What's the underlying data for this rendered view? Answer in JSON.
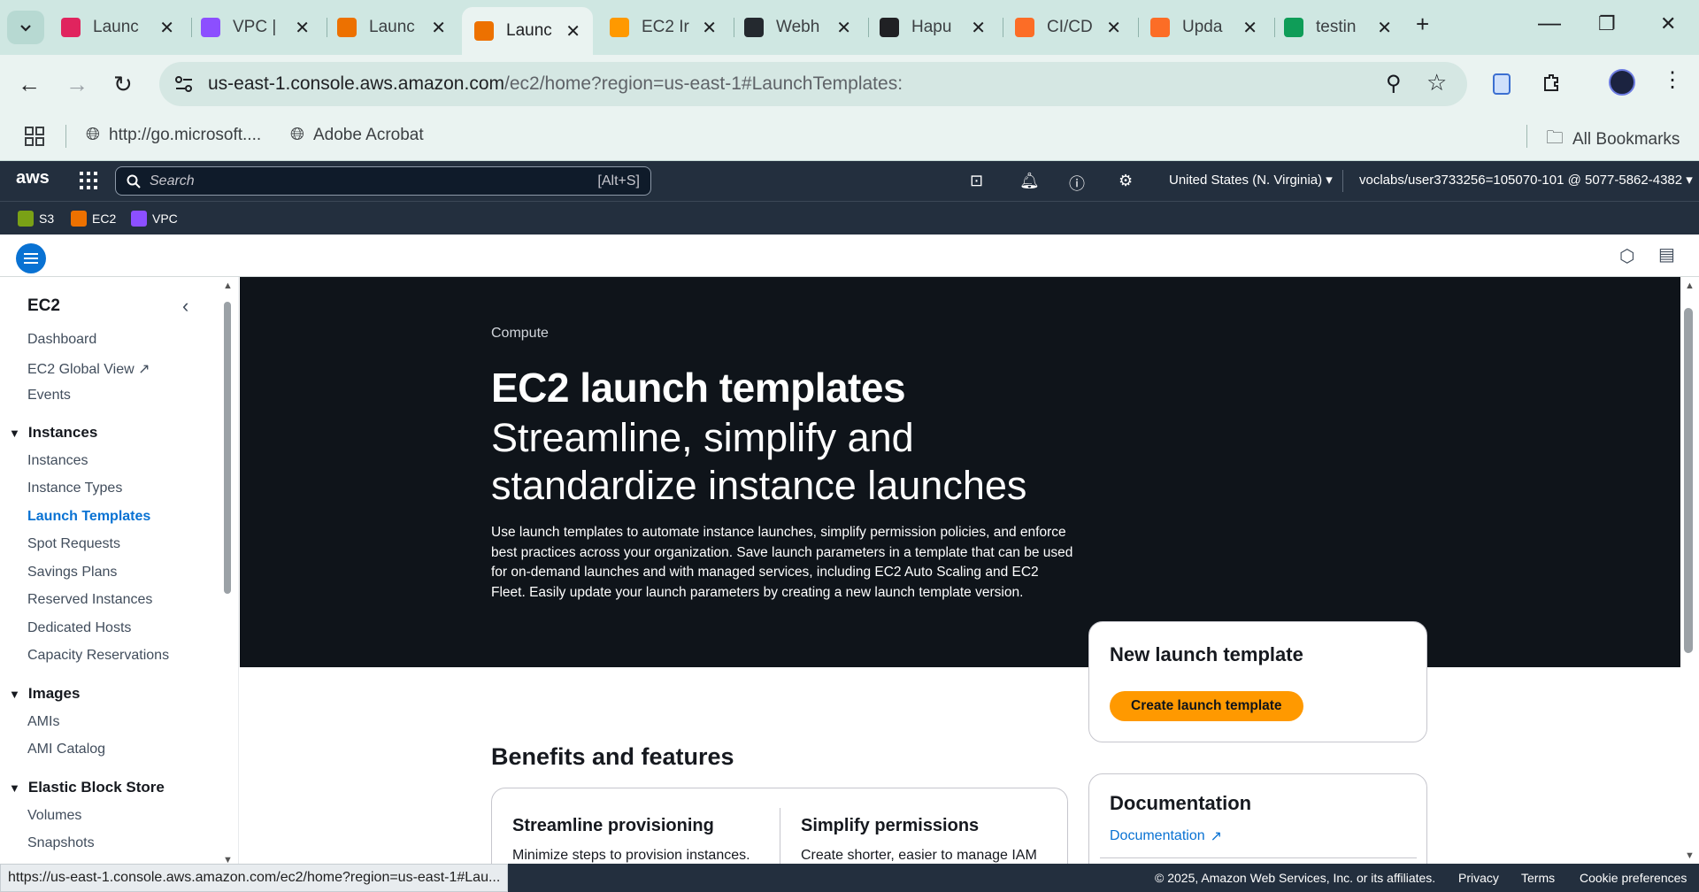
{
  "browser": {
    "tabs": [
      {
        "title": "Launc",
        "color": "#e0245e"
      },
      {
        "title": "VPC |",
        "color": "#8c4fff"
      },
      {
        "title": "Launc",
        "color": "#ed7100"
      },
      {
        "title": "Launc",
        "color": "#ed7100"
      },
      {
        "title": "EC2 Ir",
        "color": "#ff9900"
      },
      {
        "title": "Webh",
        "color": "#24292f"
      },
      {
        "title": "Hapu",
        "color": "#202124"
      },
      {
        "title": "CI/CD",
        "color": "#fc6d26"
      },
      {
        "title": "Upda",
        "color": "#fc6d26"
      },
      {
        "title": "testin",
        "color": "#0f9d58"
      }
    ],
    "close_glyph": "✕",
    "new_tab": "+",
    "url_host": "us-east-1.console.aws.amazon.com",
    "url_path": "/ec2/home?region=us-east-1#LaunchTemplates:",
    "bookmarks": [
      "http://go.microsoft....",
      "Adobe Acrobat"
    ],
    "all_bookmarks": "All Bookmarks"
  },
  "aws": {
    "logo": "aws",
    "search_placeholder": "Search",
    "search_shortcut": "[Alt+S]",
    "region": "United States (N. Virginia) ▾",
    "account": "voclabs/user3733256=105070-101 @ 5077-5862-4382 ▾",
    "favorites": [
      {
        "label": "S3",
        "color": "#7aa116"
      },
      {
        "label": "EC2",
        "color": "#ed7100"
      },
      {
        "label": "VPC",
        "color": "#8c4fff"
      }
    ]
  },
  "sidebar": {
    "title": "EC2",
    "top_items": [
      "Dashboard",
      "EC2 Global View",
      "Events"
    ],
    "sections": [
      {
        "label": "Instances",
        "items": [
          "Instances",
          "Instance Types",
          "Launch Templates",
          "Spot Requests",
          "Savings Plans",
          "Reserved Instances",
          "Dedicated Hosts",
          "Capacity Reservations"
        ]
      },
      {
        "label": "Images",
        "items": [
          "AMIs",
          "AMI Catalog"
        ]
      },
      {
        "label": "Elastic Block Store",
        "items": [
          "Volumes",
          "Snapshots"
        ]
      }
    ],
    "active": "Launch Templates"
  },
  "hero": {
    "breadcrumb": "Compute",
    "title": "EC2 launch templates",
    "subtitle": "Streamline, simplify and standardize instance launches",
    "description": "Use launch templates to automate instance launches, simplify permission policies, and enforce best practices across your organization. Save launch parameters in a template that can be used for on-demand launches and with managed services, including EC2 Auto Scaling and EC2 Fleet. Easily update your launch parameters by creating a new launch template version."
  },
  "new_template": {
    "title": "New launch template",
    "button": "Create launch template"
  },
  "benefits": {
    "heading": "Benefits and features",
    "features": [
      {
        "title": "Streamline provisioning",
        "desc": "Minimize steps to provision instances."
      },
      {
        "title": "Simplify permissions",
        "desc": "Create shorter, easier to manage IAM"
      }
    ]
  },
  "documentation": {
    "title": "Documentation",
    "link": "Documentation"
  },
  "footer": {
    "status_url": "https://us-east-1.console.aws.amazon.com/ec2/home?region=us-east-1#Lau...",
    "copyright": "© 2025, Amazon Web Services, Inc. or its affiliates.",
    "links": [
      "Privacy",
      "Terms",
      "Cookie preferences"
    ]
  }
}
